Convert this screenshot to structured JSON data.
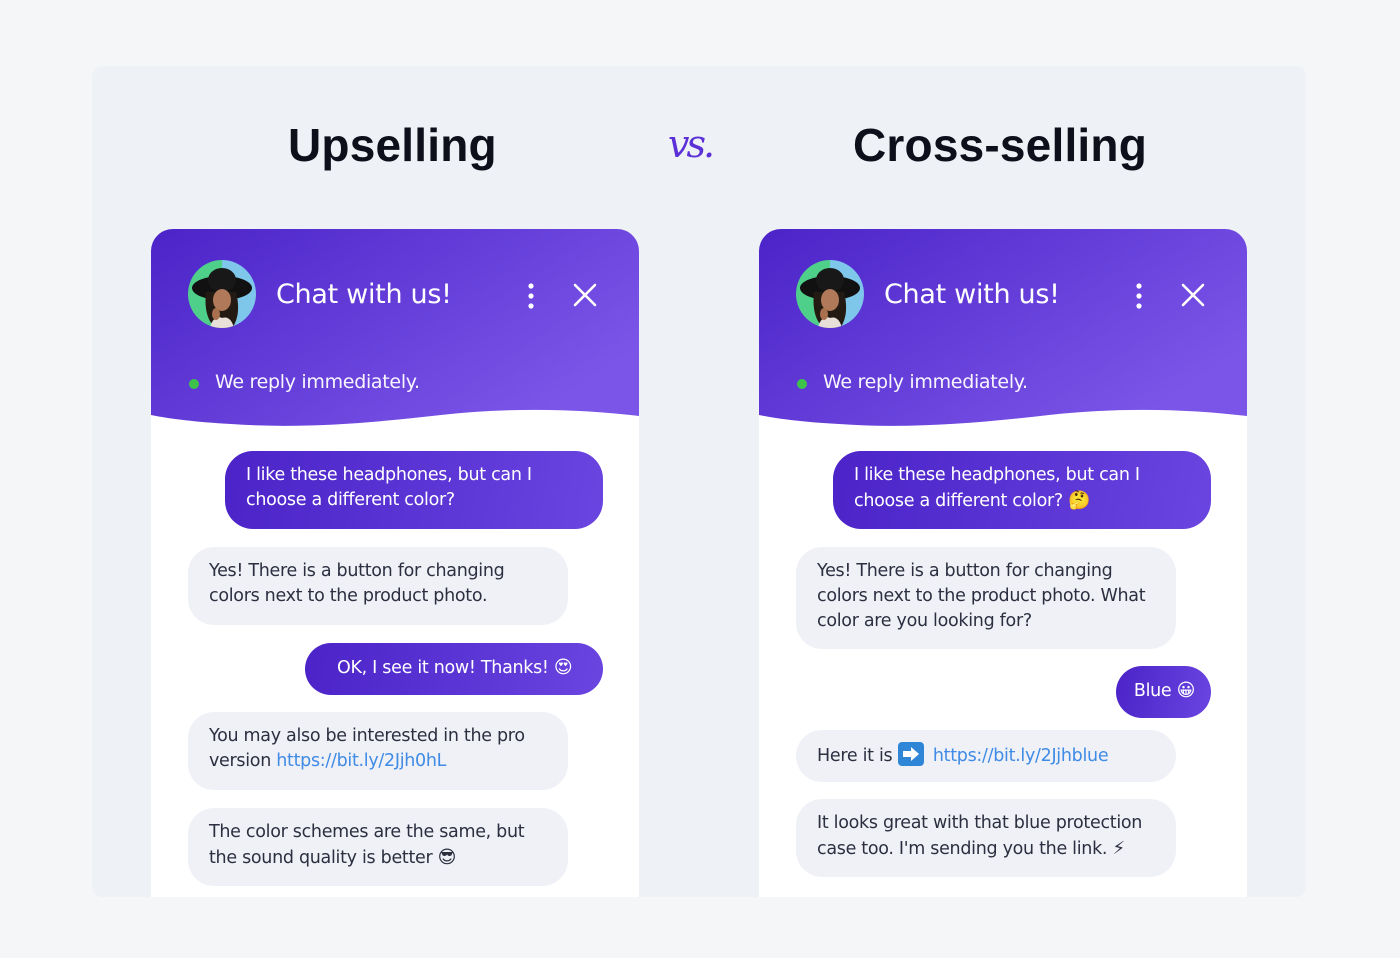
{
  "titles": {
    "left": "Upselling",
    "vs": "vs.",
    "right": "Cross-selling"
  },
  "colors": {
    "accent": "#5b30d6",
    "header_gradient_start": "#4b23c8",
    "header_gradient_end": "#7b55e8",
    "status_online": "#3fc24b",
    "link": "#3f8be6",
    "bot_bubble": "#eff1f6"
  },
  "panels": [
    {
      "id": "upselling",
      "header": {
        "title": "Chat with us!",
        "status": "We reply immediately.",
        "avatar": "agent-avatar",
        "menu_icon": "more-vertical-icon",
        "close_icon": "close-icon"
      },
      "messages": [
        {
          "from": "user",
          "text": "I like these headphones, but can I choose a different color?"
        },
        {
          "from": "bot",
          "text": "Yes! There is a button for changing colors next to the product photo."
        },
        {
          "from": "user",
          "text": "OK, I see it now! Thanks!",
          "emoji": "😍"
        },
        {
          "from": "bot",
          "text": "You may also be interested in the pro version",
          "link": "https://bit.ly/2Jjh0hL"
        },
        {
          "from": "bot",
          "text": "The color schemes are the same, but the sound quality is better",
          "emoji": "😎"
        }
      ]
    },
    {
      "id": "cross-selling",
      "header": {
        "title": "Chat with us!",
        "status": "We reply immediately.",
        "avatar": "agent-avatar",
        "menu_icon": "more-vertical-icon",
        "close_icon": "close-icon"
      },
      "messages": [
        {
          "from": "user",
          "text": "I like these headphones, but can I choose a different color?",
          "emoji": "🤔"
        },
        {
          "from": "bot",
          "text": "Yes! There is a button for changing colors next to the product photo. What color are you looking for?"
        },
        {
          "from": "user",
          "text": "Blue",
          "emoji": "😀"
        },
        {
          "from": "bot",
          "text": "Here it is",
          "icon": "right-arrow-icon",
          "link": "https://bit.ly/2Jjhblue"
        },
        {
          "from": "bot",
          "text": "It looks great with that blue protection case too. I'm sending you the link.",
          "emoji": "⚡"
        }
      ]
    }
  ]
}
